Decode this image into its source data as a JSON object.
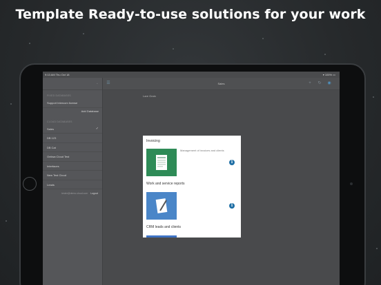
{
  "headline": "Template Ready-to-use solutions for your work",
  "status_bar": {
    "time": "9:13 AM",
    "date": "Thu Oct 18",
    "battery": "100%"
  },
  "sidebar": {
    "section1_label": "FIXED DATABASES",
    "row1": "Support Intercom license",
    "action": "Add Database",
    "section2_label": "CLOUD DATABASES",
    "items": [
      {
        "label": "Sales",
        "checked": true
      },
      {
        "label": "DB 123"
      },
      {
        "label": "DB Cat"
      },
      {
        "label": "Ontiwa Cloud Test"
      },
      {
        "label": "Interfaces"
      },
      {
        "label": "New Test Cloud"
      },
      {
        "label": "Leads"
      }
    ],
    "footer_user": "tester@demo.cloud.com",
    "logout": "Logout"
  },
  "main": {
    "title": "Sales",
    "label": "Lare Grain"
  },
  "templates": [
    {
      "title": "Invoicing",
      "description": "Management of invoices and clients",
      "color": "#2e8b57"
    },
    {
      "title": "Work and service reports",
      "description": "",
      "color": "#4a86c8"
    },
    {
      "title": "CRM leads and clients",
      "description": "",
      "color": "#3f73c4"
    }
  ],
  "colors": {
    "accent": "#1f6fa5",
    "invoice_thumb": "#2e8b57",
    "report_thumb": "#4a86c8"
  }
}
